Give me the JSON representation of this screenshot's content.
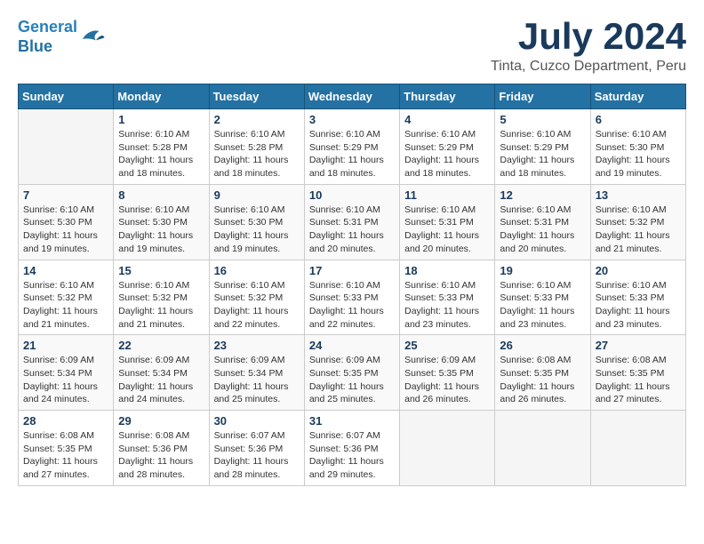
{
  "header": {
    "logo_line1": "General",
    "logo_line2": "Blue",
    "month_title": "July 2024",
    "location": "Tinta, Cuzco Department, Peru"
  },
  "days_of_week": [
    "Sunday",
    "Monday",
    "Tuesday",
    "Wednesday",
    "Thursday",
    "Friday",
    "Saturday"
  ],
  "weeks": [
    [
      {
        "day": "",
        "info": ""
      },
      {
        "day": "1",
        "info": "Sunrise: 6:10 AM\nSunset: 5:28 PM\nDaylight: 11 hours\nand 18 minutes."
      },
      {
        "day": "2",
        "info": "Sunrise: 6:10 AM\nSunset: 5:28 PM\nDaylight: 11 hours\nand 18 minutes."
      },
      {
        "day": "3",
        "info": "Sunrise: 6:10 AM\nSunset: 5:29 PM\nDaylight: 11 hours\nand 18 minutes."
      },
      {
        "day": "4",
        "info": "Sunrise: 6:10 AM\nSunset: 5:29 PM\nDaylight: 11 hours\nand 18 minutes."
      },
      {
        "day": "5",
        "info": "Sunrise: 6:10 AM\nSunset: 5:29 PM\nDaylight: 11 hours\nand 18 minutes."
      },
      {
        "day": "6",
        "info": "Sunrise: 6:10 AM\nSunset: 5:30 PM\nDaylight: 11 hours\nand 19 minutes."
      }
    ],
    [
      {
        "day": "7",
        "info": "Sunrise: 6:10 AM\nSunset: 5:30 PM\nDaylight: 11 hours\nand 19 minutes."
      },
      {
        "day": "8",
        "info": "Sunrise: 6:10 AM\nSunset: 5:30 PM\nDaylight: 11 hours\nand 19 minutes."
      },
      {
        "day": "9",
        "info": "Sunrise: 6:10 AM\nSunset: 5:30 PM\nDaylight: 11 hours\nand 19 minutes."
      },
      {
        "day": "10",
        "info": "Sunrise: 6:10 AM\nSunset: 5:31 PM\nDaylight: 11 hours\nand 20 minutes."
      },
      {
        "day": "11",
        "info": "Sunrise: 6:10 AM\nSunset: 5:31 PM\nDaylight: 11 hours\nand 20 minutes."
      },
      {
        "day": "12",
        "info": "Sunrise: 6:10 AM\nSunset: 5:31 PM\nDaylight: 11 hours\nand 20 minutes."
      },
      {
        "day": "13",
        "info": "Sunrise: 6:10 AM\nSunset: 5:32 PM\nDaylight: 11 hours\nand 21 minutes."
      }
    ],
    [
      {
        "day": "14",
        "info": "Sunrise: 6:10 AM\nSunset: 5:32 PM\nDaylight: 11 hours\nand 21 minutes."
      },
      {
        "day": "15",
        "info": "Sunrise: 6:10 AM\nSunset: 5:32 PM\nDaylight: 11 hours\nand 21 minutes."
      },
      {
        "day": "16",
        "info": "Sunrise: 6:10 AM\nSunset: 5:32 PM\nDaylight: 11 hours\nand 22 minutes."
      },
      {
        "day": "17",
        "info": "Sunrise: 6:10 AM\nSunset: 5:33 PM\nDaylight: 11 hours\nand 22 minutes."
      },
      {
        "day": "18",
        "info": "Sunrise: 6:10 AM\nSunset: 5:33 PM\nDaylight: 11 hours\nand 23 minutes."
      },
      {
        "day": "19",
        "info": "Sunrise: 6:10 AM\nSunset: 5:33 PM\nDaylight: 11 hours\nand 23 minutes."
      },
      {
        "day": "20",
        "info": "Sunrise: 6:10 AM\nSunset: 5:33 PM\nDaylight: 11 hours\nand 23 minutes."
      }
    ],
    [
      {
        "day": "21",
        "info": "Sunrise: 6:09 AM\nSunset: 5:34 PM\nDaylight: 11 hours\nand 24 minutes."
      },
      {
        "day": "22",
        "info": "Sunrise: 6:09 AM\nSunset: 5:34 PM\nDaylight: 11 hours\nand 24 minutes."
      },
      {
        "day": "23",
        "info": "Sunrise: 6:09 AM\nSunset: 5:34 PM\nDaylight: 11 hours\nand 25 minutes."
      },
      {
        "day": "24",
        "info": "Sunrise: 6:09 AM\nSunset: 5:35 PM\nDaylight: 11 hours\nand 25 minutes."
      },
      {
        "day": "25",
        "info": "Sunrise: 6:09 AM\nSunset: 5:35 PM\nDaylight: 11 hours\nand 26 minutes."
      },
      {
        "day": "26",
        "info": "Sunrise: 6:08 AM\nSunset: 5:35 PM\nDaylight: 11 hours\nand 26 minutes."
      },
      {
        "day": "27",
        "info": "Sunrise: 6:08 AM\nSunset: 5:35 PM\nDaylight: 11 hours\nand 27 minutes."
      }
    ],
    [
      {
        "day": "28",
        "info": "Sunrise: 6:08 AM\nSunset: 5:35 PM\nDaylight: 11 hours\nand 27 minutes."
      },
      {
        "day": "29",
        "info": "Sunrise: 6:08 AM\nSunset: 5:36 PM\nDaylight: 11 hours\nand 28 minutes."
      },
      {
        "day": "30",
        "info": "Sunrise: 6:07 AM\nSunset: 5:36 PM\nDaylight: 11 hours\nand 28 minutes."
      },
      {
        "day": "31",
        "info": "Sunrise: 6:07 AM\nSunset: 5:36 PM\nDaylight: 11 hours\nand 29 minutes."
      },
      {
        "day": "",
        "info": ""
      },
      {
        "day": "",
        "info": ""
      },
      {
        "day": "",
        "info": ""
      }
    ]
  ]
}
